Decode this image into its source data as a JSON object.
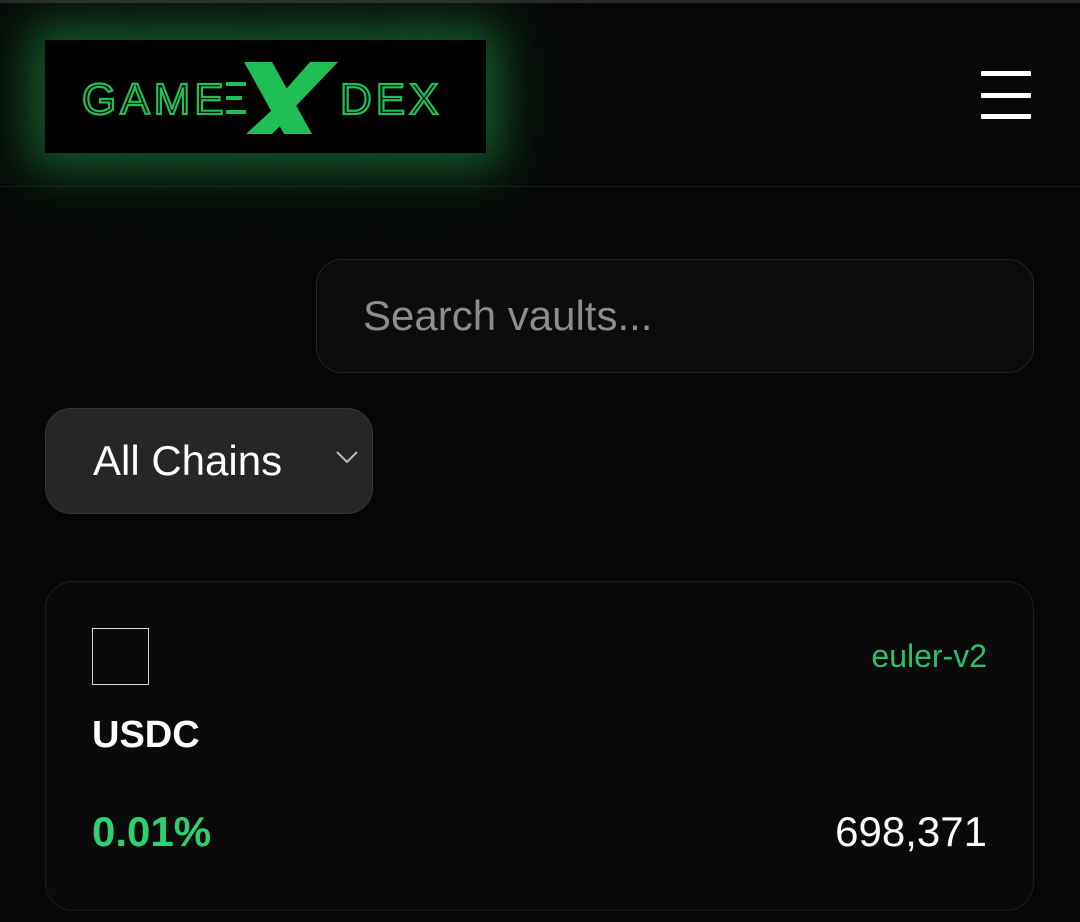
{
  "header": {
    "logo_text_left": "GAME",
    "logo_text_right": "DEX",
    "logo_color": "#1fbf55",
    "menu_icon": "hamburger-menu-icon"
  },
  "search": {
    "placeholder": "Search vaults...",
    "value": ""
  },
  "chain_filter": {
    "selected": "All Chains",
    "icon": "chevron-down-icon"
  },
  "vaults": [
    {
      "token": "USDC",
      "protocol": "euler-v2",
      "apy": "0.01%",
      "tvl": "698,371"
    }
  ],
  "colors": {
    "accent": "#2fd06f",
    "background": "#070707",
    "card": "#0a0a0a"
  }
}
